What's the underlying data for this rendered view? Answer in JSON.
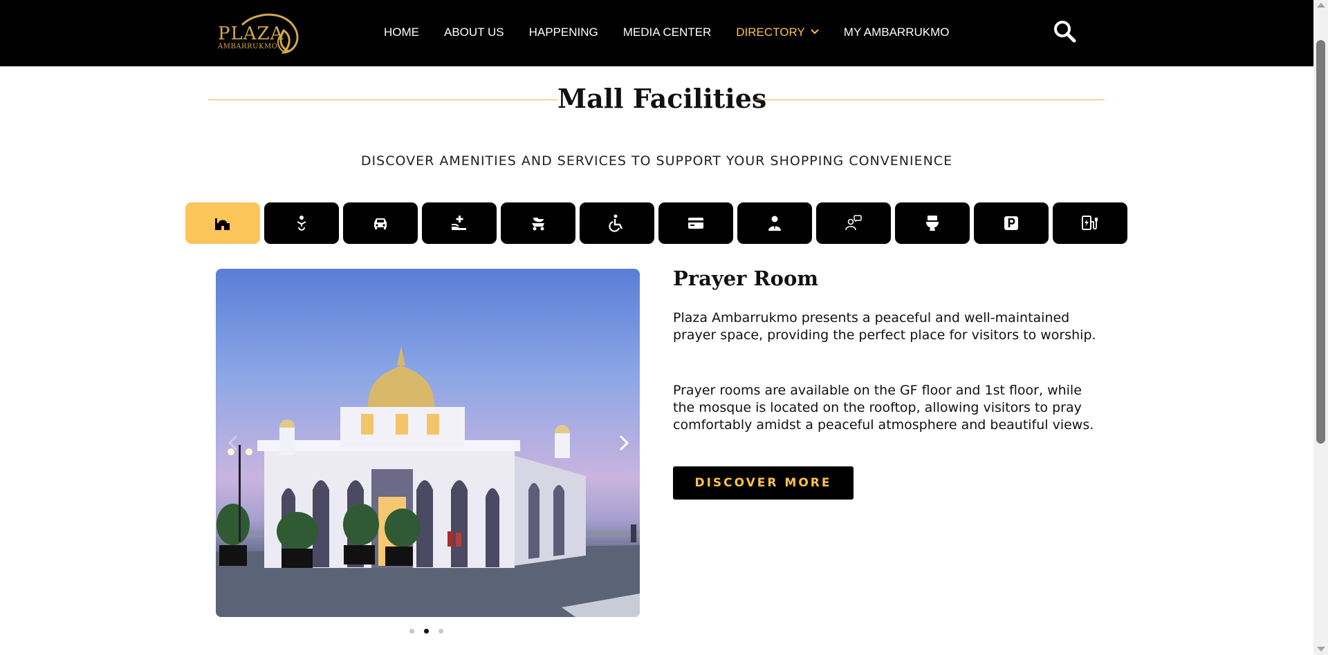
{
  "header": {
    "logo": {
      "word": "PLAZA",
      "sub": "AMBARRUKMO"
    },
    "nav": [
      {
        "label": "HOME"
      },
      {
        "label": "ABOUT US"
      },
      {
        "label": "HAPPENING"
      },
      {
        "label": "MEDIA CENTER"
      },
      {
        "label": "DIRECTORY",
        "active": true,
        "icon": "chevron-down-icon"
      },
      {
        "label": "MY AMBARRUKMO"
      }
    ],
    "search_icon": "search-icon",
    "colors": {
      "background": "#000000",
      "accent": "#fcc24c",
      "text": "#ffffff"
    }
  },
  "section": {
    "title": "Mall Facilities",
    "subtitle": "DISCOVER AMENITIES AND SERVICES TO SUPPORT YOUR SHOPPING CONVENIENCE"
  },
  "facility_tabs": [
    {
      "icon": "prayer-room-icon",
      "active": true
    },
    {
      "icon": "nursery-room-icon"
    },
    {
      "icon": "car-icon"
    },
    {
      "icon": "first-aid-icon"
    },
    {
      "icon": "stroller-icon"
    },
    {
      "icon": "wheelchair-icon"
    },
    {
      "icon": "card-icon"
    },
    {
      "icon": "customer-service-icon"
    },
    {
      "icon": "information-icon"
    },
    {
      "icon": "toilet-icon"
    },
    {
      "icon": "parking-icon"
    },
    {
      "icon": "ev-charging-icon"
    }
  ],
  "slider": {
    "image": "mosque-photo",
    "prev_icon": "chevron-left-icon",
    "next_icon": "chevron-right-icon",
    "slide_count": 3,
    "active_slide": 2
  },
  "facility": {
    "title": "Prayer Room",
    "paragraph1": "Plaza Ambarrukmo presents a peaceful and well-maintained prayer space, providing the perfect place for visitors to worship.",
    "paragraph2": "Prayer rooms are available on the GF floor and 1st floor, while the mosque is located on the rooftop, allowing visitors to pray comfortably amidst a peaceful atmosphere and beautiful views.",
    "cta_label": "DISCOVER MORE"
  },
  "colors": {
    "accent": "#fcc55a",
    "heading_line": "#e9b04a",
    "tab_background": "#000000"
  }
}
